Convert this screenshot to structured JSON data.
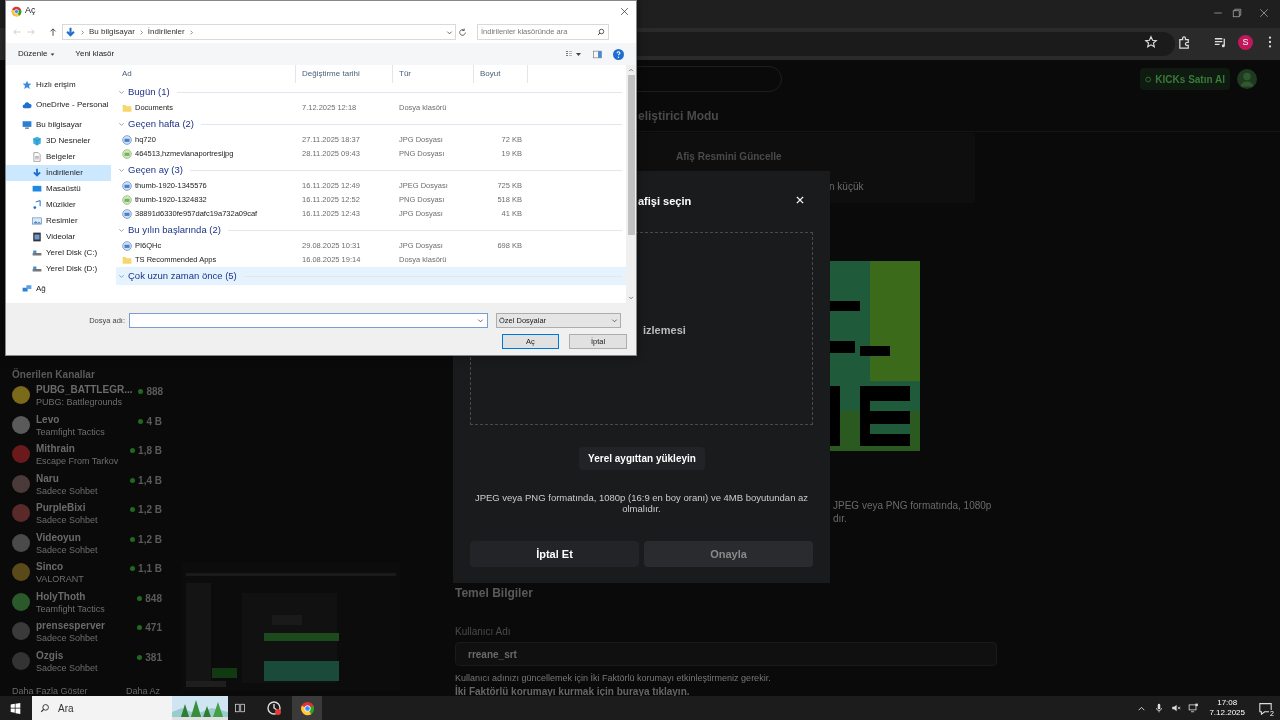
{
  "browser": {
    "profile_initial": "S"
  },
  "page": {
    "kicks_button": "KICKs Satın Al",
    "dev_mode_title": "eliştirici Modu",
    "banner_card": {
      "title": "Afiş Resmini Güncelle",
      "hint": "n küçük"
    },
    "sidebar": {
      "title": "Önerilen Kanallar",
      "channels": [
        {
          "name": "PUBG_BATTLEGR...",
          "category": "PUBG: Battlegrounds",
          "viewers": "888",
          "color": "#7a6a1a"
        },
        {
          "name": "Levo",
          "category": "Teamfight Tactics",
          "viewers": "4 B",
          "color": "#5a5a5a"
        },
        {
          "name": "Mithrain",
          "category": "Escape From Tarkov",
          "viewers": "1,8 B",
          "color": "#6a1a1a"
        },
        {
          "name": "Naru",
          "category": "Sadece Sohbet",
          "viewers": "1,4 B",
          "color": "#4a3a3a"
        },
        {
          "name": "PurpleBixi",
          "category": "Sadece Sohbet",
          "viewers": "1,2 B",
          "color": "#5a2a2a"
        },
        {
          "name": "Videoyun",
          "category": "Sadece Sohbet",
          "viewers": "1,2 B",
          "color": "#4a4a4a"
        },
        {
          "name": "Sinco",
          "category": "VALORANT",
          "viewers": "1,1 B",
          "color": "#5a4a1a"
        },
        {
          "name": "HolyThoth",
          "category": "Teamfight Tactics",
          "viewers": "848",
          "color": "#2a5a2a"
        },
        {
          "name": "prensesperver",
          "category": "Sadece Sohbet",
          "viewers": "471",
          "color": "#3a3a3a"
        },
        {
          "name": "Ozgis",
          "category": "Sadece Sohbet",
          "viewers": "381",
          "color": "#333333"
        }
      ],
      "show_more": "Daha Fazla Göster",
      "show_less": "Daha Az"
    },
    "modal": {
      "title": "afişi seçin",
      "drop_text": "izlemesi",
      "upload_button": "Yerel aygıttan yükleyin",
      "note": "JPEG veya PNG formatında, 1080p (16:9 en boy oranı) ve 4MB boyutundan az olmalıdır.",
      "cancel_button": "İptal Et",
      "confirm_button": {
        "label": "Onayla",
        "disabled": true
      }
    },
    "behind_note": [
      "JPEG veya PNG formatında, 1080p",
      "dır."
    ],
    "basic_info": {
      "title": "Temel Bilgiler",
      "username_label": "Kullanıcı Adı",
      "username_value": "rreane_srt",
      "help": "Kullanıcı adınızı güncellemek için İki Faktörlü korumayı etkinleştirmeniz gerekir.",
      "link": "İki Faktörlü korumayı kurmak için buraya tıklayın."
    }
  },
  "file_dialog": {
    "title": "Aç",
    "breadcrumbs": [
      "Bu bilgisayar",
      "İndirilenler"
    ],
    "search": {
      "placeholder": "İndirilenler klasöründe ara"
    },
    "toolbar": [
      "Düzenle",
      "Yeni klasör"
    ],
    "nav": [
      {
        "label": "Hızlı erişim",
        "kind": "star",
        "selected": false
      },
      {
        "label": "OneDrive - Personal",
        "kind": "cloud",
        "selected": false
      },
      {
        "label": "Bu bilgisayar",
        "kind": "pc",
        "selected": false,
        "children": [
          {
            "label": "3D Nesneler",
            "kind": "cube",
            "selected": false
          },
          {
            "label": "Belgeler",
            "kind": "doc",
            "selected": false
          },
          {
            "label": "İndirilenler",
            "kind": "download",
            "selected": true
          },
          {
            "label": "Masaüstü",
            "kind": "desktop",
            "selected": false
          },
          {
            "label": "Müzikler",
            "kind": "music",
            "selected": false
          },
          {
            "label": "Resimler",
            "kind": "pictures",
            "selected": false
          },
          {
            "label": "Videolar",
            "kind": "video",
            "selected": false
          },
          {
            "label": "Yerel Disk (C:)",
            "kind": "disk",
            "selected": false
          },
          {
            "label": "Yerel Disk (D:)",
            "kind": "disk",
            "selected": false
          }
        ]
      },
      {
        "label": "Ağ",
        "kind": "network",
        "selected": false
      }
    ],
    "columns": [
      "Ad",
      "Değiştirme tarihi",
      "Tür",
      "Boyut"
    ],
    "groups": [
      {
        "label": "Bugün (1)",
        "highlighted": false,
        "files": [
          {
            "name": "Documents",
            "date": "7.12.2025 12:18",
            "type": "Dosya klasörü",
            "kind": "folder"
          }
        ]
      },
      {
        "label": "Geçen hafta (2)",
        "highlighted": false,
        "files": [
          {
            "name": "hq720",
            "date": "27.11.2025 18:37",
            "type": "JPG Dosyası",
            "size": "72 KB",
            "kind": "jpg"
          },
          {
            "name": "464513,hzmevlanaportresijpg",
            "date": "28.11.2025 09:43",
            "type": "PNG Dosyası",
            "size": "19 KB",
            "kind": "png"
          }
        ]
      },
      {
        "label": "Geçen ay (3)",
        "highlighted": false,
        "files": [
          {
            "name": "thumb-1920-1345576",
            "date": "16.11.2025 12:49",
            "type": "JPEG Dosyası",
            "size": "725 KB",
            "kind": "jpg"
          },
          {
            "name": "thumb-1920-1324832",
            "date": "16.11.2025 12:52",
            "type": "PNG Dosyası",
            "size": "518 KB",
            "kind": "png"
          },
          {
            "name": "38891d6330fe957dafc19a732a09caf",
            "date": "16.11.2025 12:43",
            "type": "JPG Dosyası",
            "size": "41 KB",
            "kind": "jpg"
          }
        ]
      },
      {
        "label": "Bu yılın başlarında (2)",
        "highlighted": false,
        "files": [
          {
            "name": "PI6QHc",
            "date": "29.08.2025 10:31",
            "type": "JPG Dosyası",
            "size": "698 KB",
            "kind": "jpg"
          },
          {
            "name": "TS Recommended Apps",
            "date": "16.08.2025 19:14",
            "type": "Dosya klasörü",
            "kind": "folder"
          }
        ]
      },
      {
        "label": "Çok uzun zaman önce (5)",
        "highlighted": true
      }
    ],
    "filename_label": "Dosya adı:",
    "filter": "Özel Dosyalar",
    "open_button": "Aç",
    "cancel_button": "İptal"
  },
  "taskbar": {
    "search_placeholder": "Ara",
    "time": "17:08",
    "date": "7.12.2025",
    "notification_count": "2"
  }
}
